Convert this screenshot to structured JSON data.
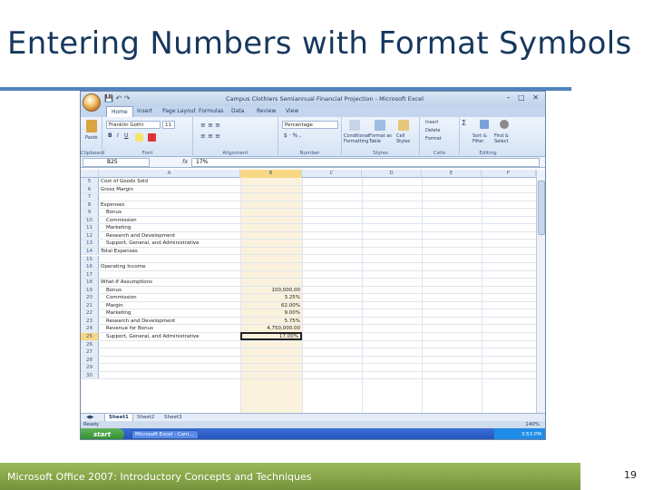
{
  "slide": {
    "title": "Entering Numbers with Format Symbols",
    "footer": "Microsoft Office 2007: Introductory Concepts and Techniques",
    "page_number": "19",
    "colors": {
      "title_rule": "#4f81bd",
      "footer_green": "#9bbb59",
      "title_text": "#17375e"
    }
  },
  "excel": {
    "window_title": "Campus Clothiers Semiannual Financial Projection - Microsoft Excel",
    "tabs": [
      "Home",
      "Insert",
      "Page Layout",
      "Formulas",
      "Data",
      "Review",
      "View"
    ],
    "ribbon": {
      "font_name": "Franklin Gothi",
      "font_size": "11",
      "number_format": "Percentage",
      "groups": [
        "Clipboard",
        "Font",
        "Alignment",
        "Number",
        "Styles",
        "Cells",
        "Editing"
      ],
      "paste_label": "Paste",
      "styles_buttons": [
        "Conditional Formatting",
        "Format as Table",
        "Cell Styles"
      ],
      "cells_buttons": [
        "Insert",
        "Delete",
        "Format"
      ],
      "editing_buttons": [
        "Sort & Filter",
        "Find & Select"
      ]
    },
    "name_box": "B25",
    "fx_label": "fx",
    "formula_value": "17%",
    "column_headers": [
      "A",
      "B",
      "C",
      "D",
      "E",
      "F"
    ],
    "rows": [
      {
        "num": "5",
        "a": "Cost of Goods Sold",
        "b": ""
      },
      {
        "num": "6",
        "a": "Gross Margin",
        "b": ""
      },
      {
        "num": "7",
        "a": "",
        "b": ""
      },
      {
        "num": "8",
        "a": "Expenses",
        "b": ""
      },
      {
        "num": "9",
        "a": "Bonus",
        "b": "",
        "indent": true
      },
      {
        "num": "10",
        "a": "Commission",
        "b": "",
        "indent": true
      },
      {
        "num": "11",
        "a": "Marketing",
        "b": "",
        "indent": true
      },
      {
        "num": "12",
        "a": "Research and Development",
        "b": "",
        "indent": true
      },
      {
        "num": "13",
        "a": "Support, General, and Administrative",
        "b": "",
        "indent": true
      },
      {
        "num": "14",
        "a": "Total Expenses",
        "b": ""
      },
      {
        "num": "15",
        "a": "",
        "b": ""
      },
      {
        "num": "16",
        "a": "Operating Income",
        "b": ""
      },
      {
        "num": "17",
        "a": "",
        "b": ""
      },
      {
        "num": "18",
        "a": "What-If Assumptions",
        "b": ""
      },
      {
        "num": "19",
        "a": "Bonus",
        "b": "100,000.00",
        "indent": true
      },
      {
        "num": "20",
        "a": "Commission",
        "b": "3.25%",
        "indent": true
      },
      {
        "num": "21",
        "a": "Margin",
        "b": "62.00%",
        "indent": true
      },
      {
        "num": "22",
        "a": "Marketing",
        "b": "9.00%",
        "indent": true
      },
      {
        "num": "23",
        "a": "Research and Development",
        "b": "5.75%",
        "indent": true
      },
      {
        "num": "24",
        "a": "Revenue for Bonus",
        "b": "4,750,000.00",
        "indent": true
      },
      {
        "num": "25",
        "a": "Support, General, and Administrative",
        "b": "17.00%",
        "indent": true,
        "active": true
      },
      {
        "num": "26",
        "a": "",
        "b": ""
      },
      {
        "num": "27",
        "a": "",
        "b": ""
      },
      {
        "num": "28",
        "a": "",
        "b": ""
      },
      {
        "num": "29",
        "a": "",
        "b": ""
      },
      {
        "num": "30",
        "a": "",
        "b": ""
      }
    ],
    "sheet_tabs": [
      "Sheet1",
      "Sheet2",
      "Sheet3"
    ],
    "status": "Ready",
    "zoom": "140%",
    "taskbar": {
      "start": "start",
      "task_item": "Microsoft Excel - Cam...",
      "clock": "3:53 PM"
    }
  }
}
